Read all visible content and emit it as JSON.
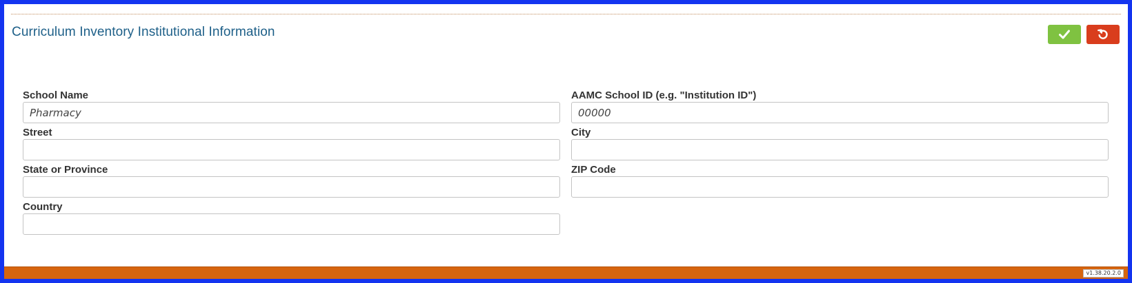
{
  "section": {
    "title": "Curriculum Inventory Institutional Information"
  },
  "actions": {
    "save_icon": "check-icon",
    "cancel_icon": "undo-icon",
    "save_color": "#7fc241",
    "cancel_color": "#d93d1d"
  },
  "form": {
    "school_name": {
      "label": "School Name",
      "value": "",
      "placeholder": "Pharmacy"
    },
    "aamc_id": {
      "label": "AAMC School ID (e.g. \"Institution ID\")",
      "value": "",
      "placeholder": "00000"
    },
    "street": {
      "label": "Street",
      "value": "",
      "placeholder": ""
    },
    "city": {
      "label": "City",
      "value": "",
      "placeholder": ""
    },
    "state": {
      "label": "State or Province",
      "value": "",
      "placeholder": ""
    },
    "zip": {
      "label": "ZIP Code",
      "value": "",
      "placeholder": ""
    },
    "country": {
      "label": "Country",
      "value": "",
      "placeholder": ""
    }
  },
  "footer": {
    "version": "v1.38.20.2.0",
    "color": "#d6650f"
  },
  "theme": {
    "frame_border": "#1334f0",
    "title_color": "#1d5f88"
  }
}
